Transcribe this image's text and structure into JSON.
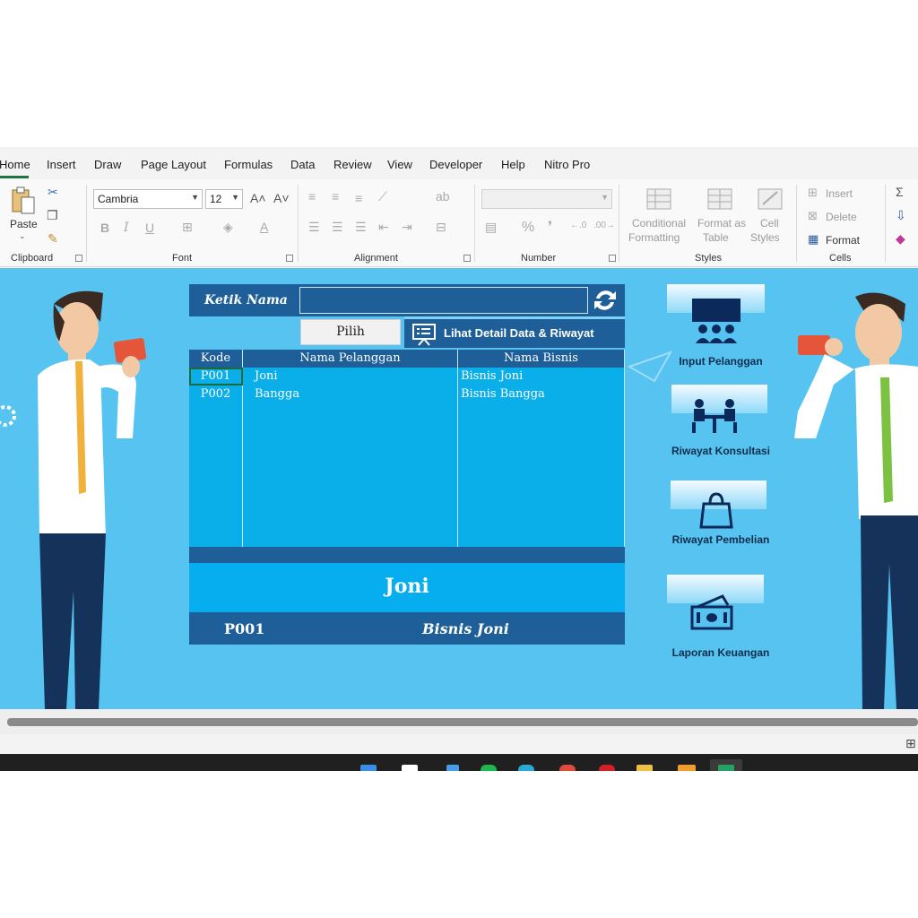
{
  "ribbon": {
    "tabs": [
      "Home",
      "Insert",
      "Draw",
      "Page Layout",
      "Formulas",
      "Data",
      "Review",
      "View",
      "Developer",
      "Help",
      "Nitro Pro"
    ],
    "clipboard": {
      "paste_label": "Paste",
      "group_label": "Clipboard"
    },
    "font": {
      "font_name": "Cambria",
      "font_size": "12",
      "group_label": "Font",
      "bold": "B",
      "italic": "I",
      "underline": "U"
    },
    "alignment": {
      "group_label": "Alignment"
    },
    "number": {
      "group_label": "Number",
      "percent": "%"
    },
    "styles": {
      "conditional_1": "Conditional",
      "conditional_2": "Formatting",
      "format_table_1": "Format as",
      "format_table_2": "Table",
      "cell_styles_1": "Cell",
      "cell_styles_2": "Styles",
      "group_label": "Styles"
    },
    "cells": {
      "insert": "Insert",
      "delete": "Delete",
      "format": "Format",
      "group_label": "Cells"
    }
  },
  "form": {
    "title": "Ketik Nama",
    "input_value": "",
    "pick_button": "Pilih",
    "detail_button": "Lihat Detail Data & Riwayat"
  },
  "table": {
    "headers": [
      "Kode",
      "Nama Pelanggan",
      "Nama Bisnis"
    ],
    "rows": [
      {
        "kode": "P001",
        "nama": "Joni",
        "bisnis": "Bisnis Joni"
      },
      {
        "kode": "P002",
        "nama": "Bangga",
        "bisnis": "Bisnis Bangga"
      }
    ]
  },
  "selected": {
    "name": "Joni",
    "code": "P001",
    "business": "Bisnis Joni"
  },
  "menu": [
    {
      "label": "Input Pelanggan",
      "icon": "meeting-presentation-icon"
    },
    {
      "label": "Riwayat Konsultasi",
      "icon": "consultation-table-icon"
    },
    {
      "label": "Riwayat Pembelian",
      "icon": "shopping-bag-icon"
    },
    {
      "label": "Laporan Keuangan",
      "icon": "money-cash-icon"
    }
  ],
  "colors": {
    "sheet_bg": "#56c3f0",
    "panel_dark": "#1f5f99",
    "table_cell": "#0aaee8",
    "highlight": "#06aeef",
    "excel_green": "#217346"
  }
}
